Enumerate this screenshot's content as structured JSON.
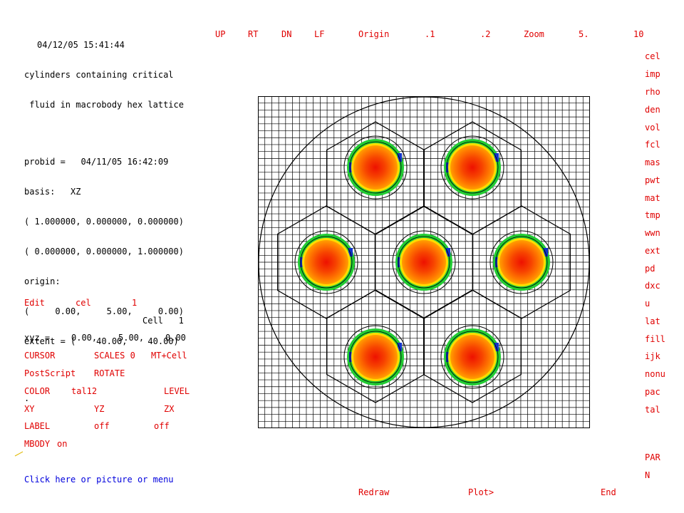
{
  "header": {
    "timestamp": "04/12/05 15:41:44",
    "title_lines": [
      "cylinders containing critical",
      " fluid in macrobody hex lattice"
    ],
    "probid": "probid =   04/11/05 16:42:09",
    "basis": "basis:   XZ",
    "basis_vec1": "( 1.000000, 0.000000, 0.000000)",
    "basis_vec2": "( 0.000000, 0.000000, 1.000000)",
    "origin_label": "origin:",
    "origin": "(     0.00,     5.00,     0.00)",
    "extent": "extent = (    40.00,    40.00)",
    "dot": "."
  },
  "top_menu": [
    "UP",
    "RT",
    "DN",
    "LF",
    "Origin",
    ".1",
    ".2",
    "Zoom",
    "5.",
    "10"
  ],
  "right_menu": [
    "cel",
    "imp",
    "rho",
    "den",
    "vol",
    "fcl",
    "mas",
    "pwt",
    "mat",
    "tmp",
    "wwn",
    "ext",
    "pd",
    "dxc",
    "u",
    "lat",
    "fill",
    "ijk",
    "nonu",
    "pac",
    "tal",
    "PAR",
    "N"
  ],
  "bottom_menu": [
    "Redraw",
    "Plot>",
    "End"
  ],
  "left_panel": {
    "edit": "Edit",
    "edit_param": "cel",
    "edit_value": "1",
    "cell_readout": "Cell   1",
    "xyz_label": "xyz =",
    "xyz_values": [
      "0.00,",
      "5.00,",
      "0.00"
    ],
    "cursor": "CURSOR",
    "scales": "SCALES 0",
    "mt_cell": "MT+Cell",
    "postscript": "PostScript",
    "rotate": "ROTATE",
    "color": "COLOR",
    "color_value": "tal12",
    "level": "LEVEL",
    "xy": "XY",
    "yz": "YZ",
    "zx": "ZX",
    "label": "LABEL",
    "label_v1": "off",
    "label_v2": "off",
    "mbody": "MBODY",
    "mbody_value": "on",
    "hint": "Click here or picture or menu"
  },
  "colors": {
    "menu_red": "#e00000",
    "hint_blue": "#0000dd",
    "grid": "#000000",
    "fuel_core": "#ee1100",
    "fuel_mid": "#ff7a00",
    "fuel_rim": "#ffdd00",
    "ring_green": "#22cc33",
    "ring_blue": "#1133cc"
  }
}
